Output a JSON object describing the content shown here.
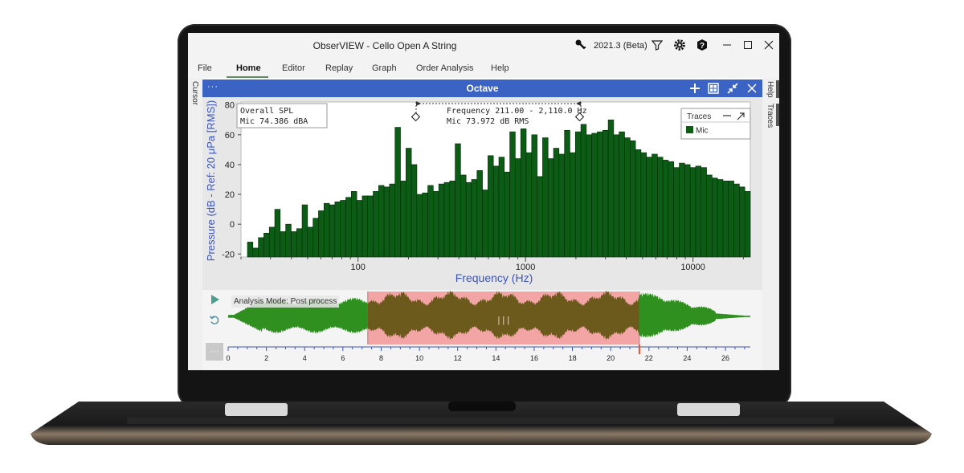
{
  "window": {
    "title": "ObserVIEW - Cello Open A String",
    "version": "2021.3 (Beta)",
    "icons": [
      "key-icon",
      "filter-icon",
      "gear-icon",
      "help-icon",
      "minimize-icon",
      "maximize-icon",
      "close-icon"
    ]
  },
  "menu": {
    "items": [
      "File",
      "Home",
      "Editor",
      "Replay",
      "Graph",
      "Order Analysis",
      "Help"
    ],
    "active": "Home"
  },
  "side": {
    "left_label": "Cursor",
    "right_labels": [
      "Help",
      "Traces"
    ]
  },
  "panel": {
    "title": "Octave",
    "menu_glyph": "···"
  },
  "overall": {
    "line1": "Overall SPL",
    "line2": "Mic  74.386  dBA"
  },
  "cursor_readout": {
    "line1": "Frequency  211.00 - 2,110.0  Hz",
    "line2": "Mic        73.972       dB RMS"
  },
  "traces_box": {
    "title": "Traces",
    "item": "Mic"
  },
  "colors": {
    "bar_fill": "#0c5c16",
    "bar_edge": "#042a08",
    "axis_text": "#3b55b8",
    "panel_header": "#3b63c4",
    "waveform": "#2f8f1f",
    "selection": "#f3a5a5",
    "selection_waveform": "#6b5a1c"
  },
  "chart_data": {
    "type": "bar",
    "xlabel": "Frequency (Hz)",
    "ylabel": "Pressure (dB - Ref: 20 μPa [RMS])",
    "x_scale": "log",
    "xlim": [
      20,
      22000
    ],
    "ylim": [
      -22,
      82
    ],
    "y_ticks": [
      "80",
      "60",
      "40",
      "20",
      "0",
      "-20"
    ],
    "x_ticks": [
      "100",
      "1000",
      "10000"
    ],
    "grid": false,
    "legend_position": "top-right",
    "series": [
      {
        "name": "Mic",
        "values": [
          -12,
          -16,
          -9,
          -6,
          -2,
          10,
          -5,
          0,
          -5,
          -3,
          13,
          -2,
          4,
          9,
          14,
          13,
          15,
          16,
          18,
          22,
          16,
          19,
          19,
          22,
          26,
          25,
          27,
          65,
          29,
          51,
          40,
          20,
          21,
          26,
          22,
          27,
          28,
          29,
          54,
          33,
          28,
          30,
          36,
          23,
          46,
          39,
          45,
          35,
          62,
          44,
          64,
          48,
          60,
          32,
          58,
          44,
          51,
          47,
          63,
          48,
          62,
          67,
          60,
          61,
          62,
          63,
          70,
          60,
          62,
          58,
          56,
          50,
          48,
          45,
          47,
          45,
          43,
          42,
          38,
          41,
          40,
          38,
          39,
          38,
          33,
          31,
          30,
          29,
          29,
          27,
          25,
          22
        ]
      }
    ]
  },
  "waveform": {
    "analysis_mode": "Analysis Mode: Post process",
    "time_ticks": [
      "0",
      "2",
      "4",
      "6",
      "8",
      "10",
      "12",
      "14",
      "16",
      "18",
      "20",
      "22",
      "24",
      "26"
    ],
    "time_range": [
      0,
      27.3
    ],
    "selection": [
      7.3,
      21.5
    ],
    "handle_glyph": "| | |"
  }
}
